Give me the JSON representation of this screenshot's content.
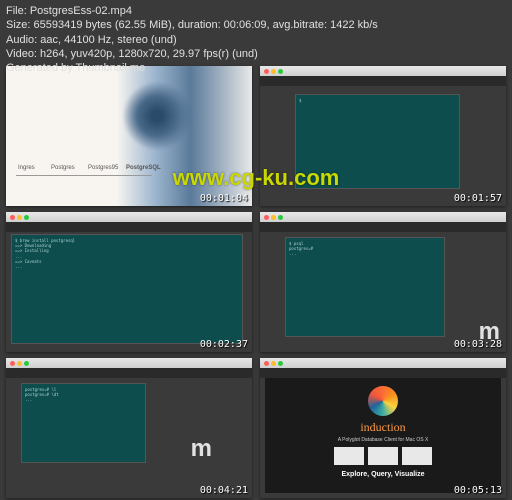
{
  "header": {
    "line1": "File: PostgresEss-02.mp4",
    "line2": "Size: 65593419 bytes (62.55 MiB), duration: 00:06:09, avg.bitrate: 1422 kb/s",
    "line3": "Audio: aac, 44100 Hz, stereo (und)",
    "line4": "Video: h264, yuv420p, 1280x720, 29.97 fps(r) (und)",
    "line5": "Generated by Thumbnail me"
  },
  "watermark": "www.cg-ku.com",
  "thumbs": {
    "t1": {
      "timestamp": "00:01:04",
      "timeline": {
        "items": [
          "Ingres",
          "Postgres",
          "Postgres95",
          "PostgreSQL"
        ]
      }
    },
    "t2": {
      "timestamp": "00:01:57"
    },
    "t3": {
      "timestamp": "00:02:37"
    },
    "t4": {
      "timestamp": "00:03:28",
      "brand": "m"
    },
    "t5": {
      "timestamp": "00:04:21",
      "brand": "m"
    },
    "t6": {
      "timestamp": "00:05:13",
      "hero_title": "induction",
      "hero_sub": "A Polyglot Database Client for Mac OS X",
      "tagline": "Explore, Query, Visualize"
    }
  }
}
